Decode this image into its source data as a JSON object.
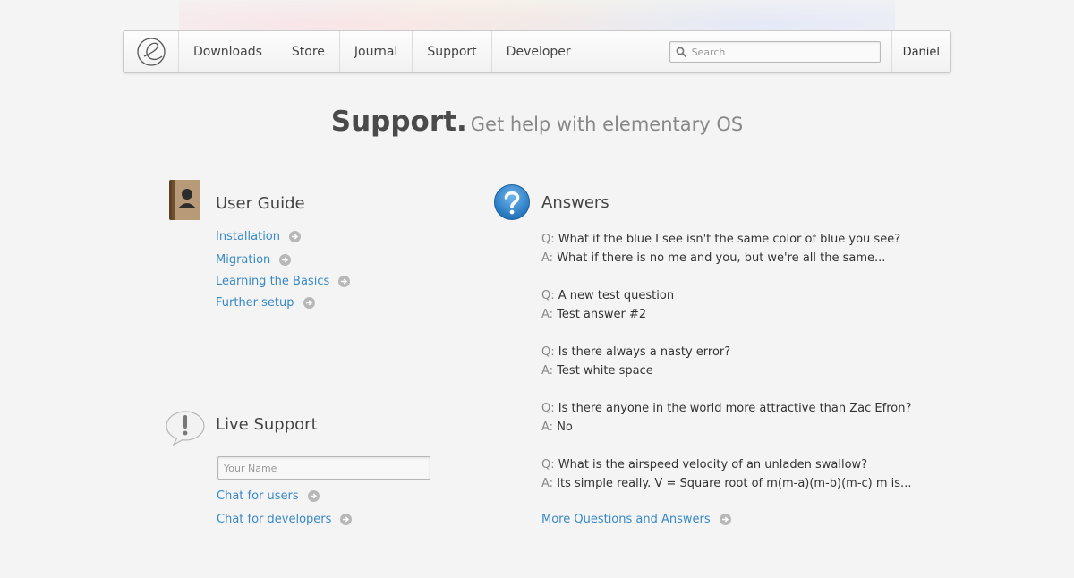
{
  "nav": {
    "items": [
      {
        "id": "downloads",
        "label": "Downloads"
      },
      {
        "id": "store",
        "label": "Store"
      },
      {
        "id": "journal",
        "label": "Journal"
      },
      {
        "id": "support",
        "label": "Support"
      },
      {
        "id": "developer",
        "label": "Developer"
      }
    ],
    "search_placeholder": "Search",
    "user": "Daniel"
  },
  "heading": {
    "title": "Support.",
    "subtitle": "Get help with elementary OS"
  },
  "user_guide": {
    "title": "User Guide",
    "links": [
      "Installation",
      "Migration",
      "Learning the Basics",
      "Further setup"
    ]
  },
  "live_support": {
    "title": "Live Support",
    "name_placeholder": "Your Name",
    "links": [
      "Chat for users",
      "Chat for developers"
    ]
  },
  "answers": {
    "title": "Answers",
    "q_prefix": "Q:",
    "a_prefix": "A:",
    "items": [
      {
        "q": "What if the blue I see isn't the same color of blue you see?",
        "a": "What if there is no me and you, but we're all the same..."
      },
      {
        "q": "A new test question",
        "a": "Test answer #2"
      },
      {
        "q": "Is there always a nasty error?",
        "a": "Test white space"
      },
      {
        "q": "Is there anyone in the world more attractive than Zac Efron?",
        "a": "No"
      },
      {
        "q": "What is the airspeed velocity of an unladen swallow?",
        "a": "Its simple really. V = Square root of m(m-a)(m-b)(m-c) m is..."
      }
    ],
    "more_link": "More Questions and Answers"
  },
  "colors": {
    "link": "#3789c8",
    "text": "#333333",
    "muted": "#888888"
  }
}
